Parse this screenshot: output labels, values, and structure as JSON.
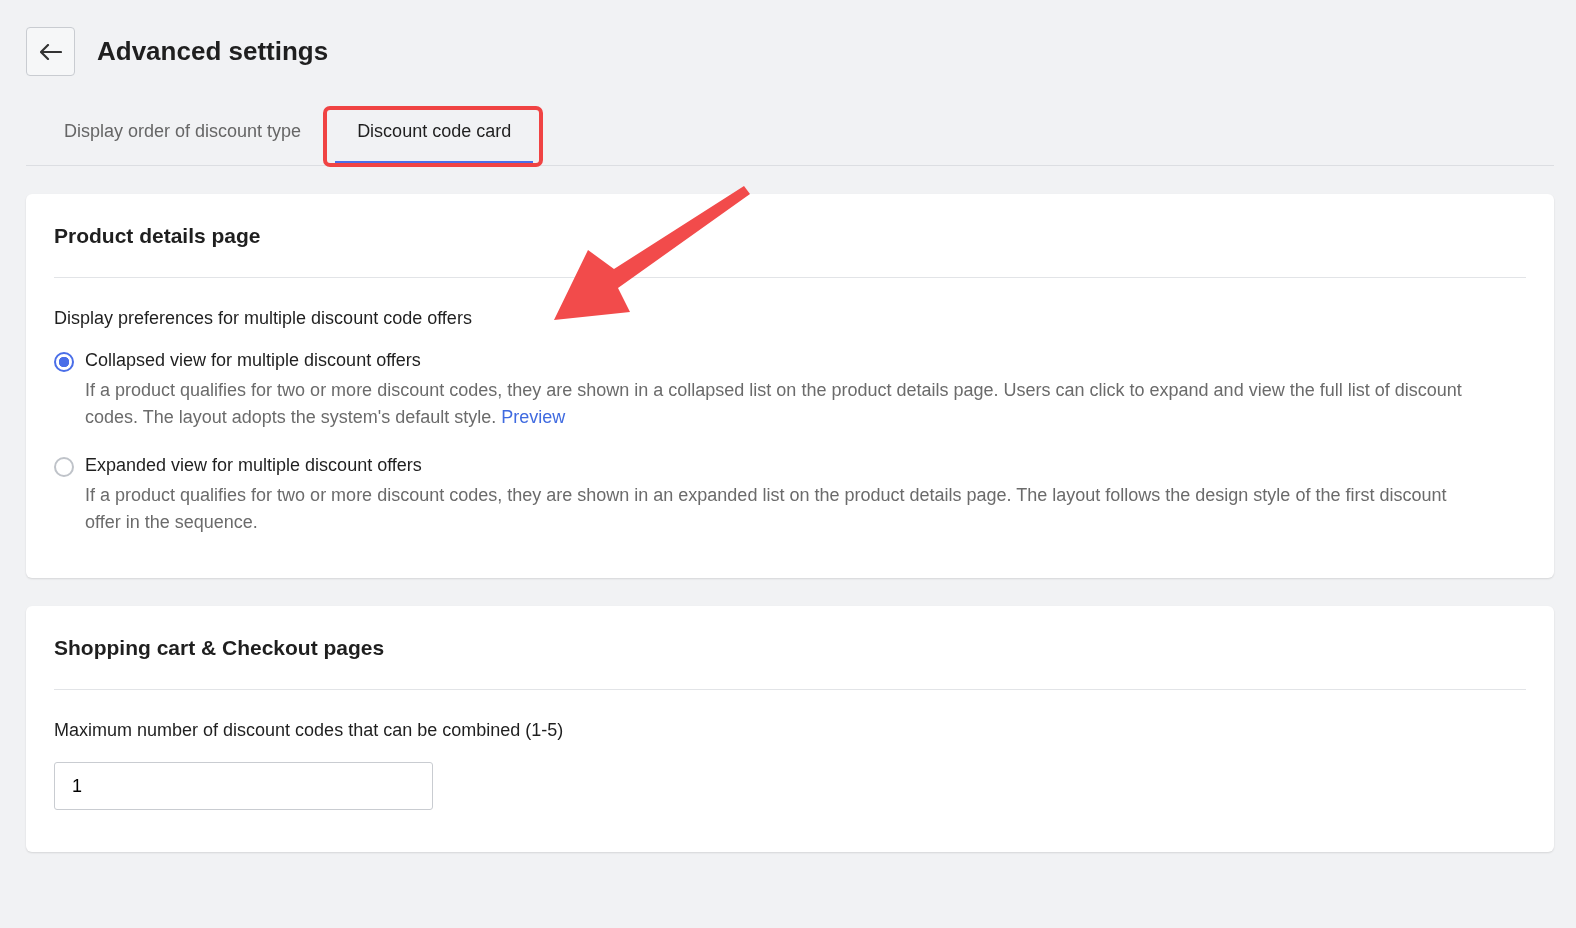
{
  "header": {
    "title": "Advanced settings"
  },
  "tabs": [
    {
      "label": "Display order of discount type",
      "selected": false
    },
    {
      "label": "Discount code card",
      "selected": true
    }
  ],
  "sections": [
    {
      "kind": "radio-group",
      "title": "Product details page",
      "question": "Display preferences for multiple discount code offers",
      "options": [
        {
          "label": "Collapsed view for multiple discount offers",
          "description": "If a product qualifies for two or more discount codes, they are shown in a collapsed list on the product details page. Users can click to expand and view the full list of discount codes. The layout adopts the system's default style.",
          "link": "Preview",
          "selected": true
        },
        {
          "label": "Expanded view for multiple discount offers",
          "description": "If a product qualifies for two or more discount codes, they are shown in an expanded list on the product details page. The layout follows the design style of the first discount offer in the sequence.",
          "selected": false
        }
      ]
    },
    {
      "kind": "number-input",
      "title": "Shopping cart & Checkout pages",
      "field_label": "Maximum number of discount codes that can be combined (1-5)",
      "value": "1"
    }
  ]
}
